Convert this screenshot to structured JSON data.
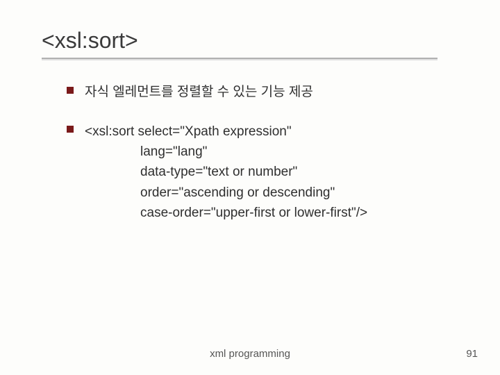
{
  "slide": {
    "title": "<xsl:sort>",
    "bullets": [
      {
        "text": "자식 엘레먼트를 정렬할 수 있는 기능 제공"
      },
      {
        "code": {
          "line1": "<xsl:sort select=\"Xpath expression\"",
          "line2": "lang=\"lang\"",
          "line3": "data-type=\"text or number\"",
          "line4": "order=\"ascending or descending\"",
          "line5": "case-order=\"upper-first or lower-first\"/>"
        }
      }
    ],
    "footer": {
      "center": "xml programming",
      "pageNumber": "91"
    }
  }
}
